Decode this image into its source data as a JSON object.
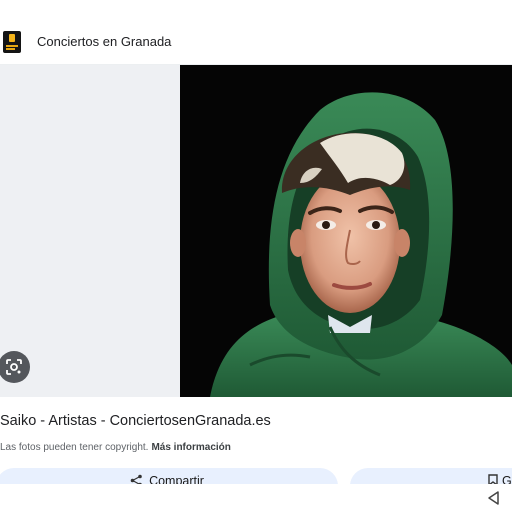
{
  "header": {
    "site_name": "Conciertos en Granada",
    "logo_icon": "conciertos-en-granada-logo"
  },
  "image": {
    "lens_icon": "google-lens-icon"
  },
  "caption": {
    "title": "Saiko - Artistas - ConciertosenGranada.es",
    "copyright_note": "Las fotos pueden tener copyright.",
    "more_info_link": "Más información"
  },
  "actions": {
    "share_label": "Compartir",
    "share_icon": "share-icon",
    "save_label": "G",
    "save_icon": "bookmark-icon"
  },
  "nav": {
    "back_icon": "back-triangle-icon"
  },
  "colors": {
    "button_bg": "#e8f0fe",
    "image_panel_bg": "#eef0f3",
    "hoodie_green": "#2f7a4c",
    "photo_bg": "#050505"
  }
}
